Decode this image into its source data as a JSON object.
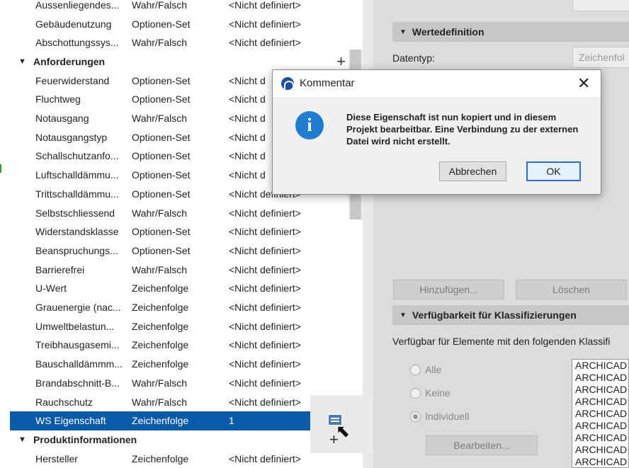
{
  "property_list": {
    "rows": [
      {
        "kind": "item",
        "name": "Aussenliegendes...",
        "type": "Wahr/Falsch",
        "value": "<Nicht definiert>"
      },
      {
        "kind": "item",
        "name": "Gebäudenutzung",
        "type": "Optionen-Set",
        "value": "<Nicht definiert>"
      },
      {
        "kind": "item",
        "name": "Abschottungssys...",
        "type": "Wahr/Falsch",
        "value": "<Nicht definiert>"
      },
      {
        "kind": "group",
        "name": "Anforderungen"
      },
      {
        "kind": "item",
        "name": "Feuerwiderstand",
        "type": "Optionen-Set",
        "value": "<Nicht d"
      },
      {
        "kind": "item",
        "name": "Fluchtweg",
        "type": "Optionen-Set",
        "value": "<Nicht d"
      },
      {
        "kind": "item",
        "name": "Notausgang",
        "type": "Wahr/Falsch",
        "value": "<Nicht d"
      },
      {
        "kind": "item",
        "name": "Notausgangstyp",
        "type": "Optionen-Set",
        "value": "<Nicht d"
      },
      {
        "kind": "item",
        "name": "Schallschutzanfo...",
        "type": "Optionen-Set",
        "value": "<Nicht d"
      },
      {
        "kind": "item",
        "name": "Luftschalldämmu...",
        "type": "Optionen-Set",
        "value": "<Nicht d"
      },
      {
        "kind": "item",
        "name": "Trittschalldämmu...",
        "type": "Optionen-Set",
        "value": "<Nicht definiert>"
      },
      {
        "kind": "item",
        "name": "Selbstschliessend",
        "type": "Wahr/Falsch",
        "value": "<Nicht definiert>"
      },
      {
        "kind": "item",
        "name": "Widerstandsklasse",
        "type": "Optionen-Set",
        "value": "<Nicht definiert>"
      },
      {
        "kind": "item",
        "name": "Beanspruchungs...",
        "type": "Optionen-Set",
        "value": "<Nicht definiert>"
      },
      {
        "kind": "item",
        "name": "Barrierefrei",
        "type": "Wahr/Falsch",
        "value": "<Nicht definiert>"
      },
      {
        "kind": "item",
        "name": "U-Wert",
        "type": "Zeichenfolge",
        "value": "<Nicht definiert>"
      },
      {
        "kind": "item",
        "name": "Grauenergie (nac...",
        "type": "Zeichenfolge",
        "value": "<Nicht definiert>"
      },
      {
        "kind": "item",
        "name": "Umweltbelastun...",
        "type": "Zeichenfolge",
        "value": "<Nicht definiert>"
      },
      {
        "kind": "item",
        "name": "Treibhausgasemi...",
        "type": "Zeichenfolge",
        "value": "<Nicht definiert>"
      },
      {
        "kind": "item",
        "name": "Bauschalldämmm...",
        "type": "Zeichenfolge",
        "value": "<Nicht definiert>"
      },
      {
        "kind": "item",
        "name": "Brandabschnitt-B...",
        "type": "Wahr/Falsch",
        "value": "<Nicht definiert>"
      },
      {
        "kind": "item",
        "name": "Rauchschutz",
        "type": "Wahr/Falsch",
        "value": "<Nicht definiert>"
      },
      {
        "kind": "item",
        "name": "WS Eigenschaft",
        "type": "Zeichenfolge",
        "value": "1",
        "selected": true
      },
      {
        "kind": "group",
        "name": "Produktinformationen"
      },
      {
        "kind": "item",
        "name": "Hersteller",
        "type": "Zeichenfolge",
        "value": "<Nicht definiert>"
      }
    ]
  },
  "right_panel": {
    "wertedefinition_header": "Wertedefinition",
    "datentyp_label": "Datentyp:",
    "datentyp_value": "Zeichenfol",
    "hinzufuegen_button": "Hinzufügen...",
    "loeschen_button": "Löschen",
    "verfuegbarkeit_header": "Verfügbarkeit für Klassifizierungen",
    "verfuegbar_text": "Verfügbar für Elemente mit den folgenden Klassifi",
    "radio_alle": "Alle",
    "radio_keine": "Keine",
    "radio_individuell": "Individuell",
    "bearbeiten_button": "Bearbeiten...",
    "classification_items": [
      "ARCHICAD",
      "ARCHICAD",
      "ARCHICAD",
      "ARCHICAD",
      "ARCHICAD",
      "ARCHICAD",
      "ARCHICAD",
      "ARCHICAD",
      "ARCHICAD"
    ]
  },
  "dialog": {
    "title": "Kommentar",
    "close_glyph": "✕",
    "info_glyph": "i",
    "message": "Diese Eigenschaft ist nun kopiert und in diesem Projekt bearbeitbar. Eine Verbindung zu der externen Datei wird nicht erstellt.",
    "cancel_button": "Abbrechen",
    "ok_button": "OK"
  },
  "glyphs": {
    "caret_down": "▼",
    "plus": "+",
    "cursor": "⬉"
  },
  "colors": {
    "selection": "#0a5aa8",
    "info_blue": "#1f7cd0",
    "ok_border": "#2a6fd6"
  }
}
